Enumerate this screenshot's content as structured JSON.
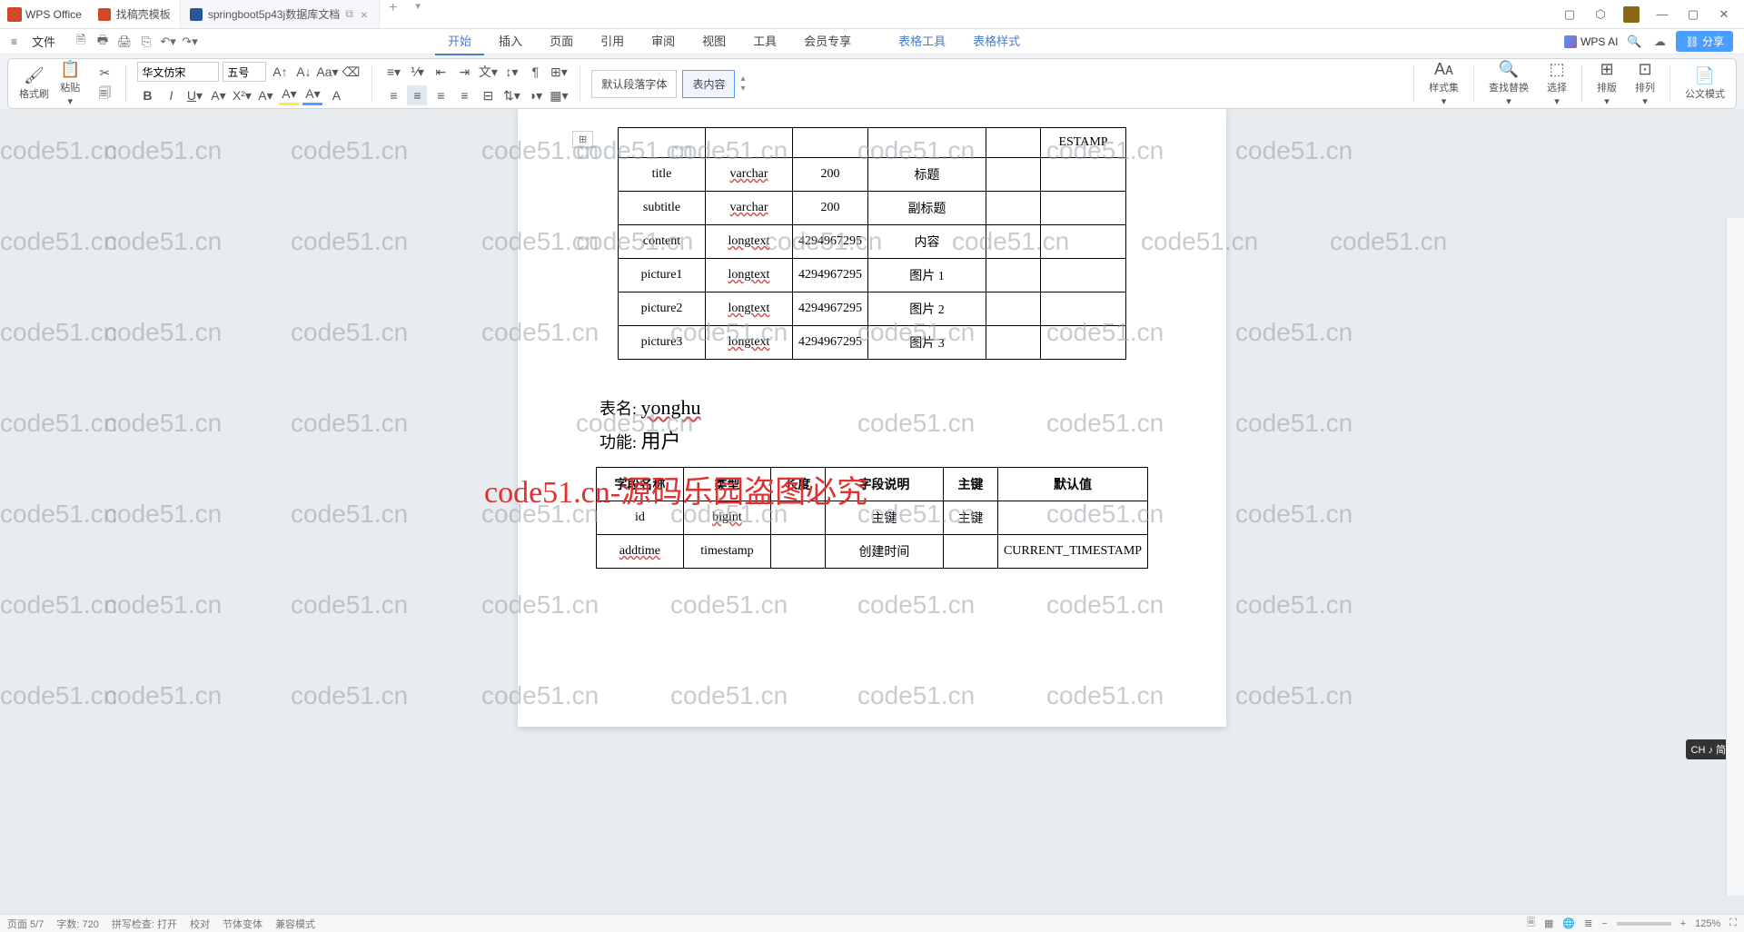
{
  "app": {
    "name": "WPS Office"
  },
  "tabs": [
    {
      "label": "找稿壳模板",
      "icon": "doc"
    },
    {
      "label": "springboot5p43j数据库文档",
      "icon": "word",
      "active": true
    }
  ],
  "file_menu": "文件",
  "menu": {
    "items": [
      "开始",
      "插入",
      "页面",
      "引用",
      "审阅",
      "视图",
      "工具",
      "会员专享"
    ],
    "extra": [
      "表格工具",
      "表格样式"
    ],
    "active": "开始",
    "ai": "WPS AI",
    "share": "分享"
  },
  "ribbon": {
    "format_painter": "格式刷",
    "paste": "粘贴",
    "font_name": "华文仿宋",
    "font_size": "五号",
    "style_default": "默认段落字体",
    "style_table": "表内容",
    "styles": "样式集",
    "find": "查找替换",
    "select": "选择",
    "layout": "排版",
    "arrange": "排列",
    "gov_mode": "公文模式"
  },
  "outline_toggle": "⊞",
  "tables": {
    "t1": {
      "rows": [
        {
          "c1": "",
          "c2": "",
          "c3": "",
          "c4": "",
          "c5": "",
          "c6": "ESTAMP"
        },
        {
          "c1": "title",
          "c2": "varchar",
          "c3": "200",
          "c4": "标题",
          "c5": "",
          "c6": ""
        },
        {
          "c1": "subtitle",
          "c2": "varchar",
          "c3": "200",
          "c4": "副标题",
          "c5": "",
          "c6": ""
        },
        {
          "c1": "content",
          "c2": "longtext",
          "c3": "4294967295",
          "c4": "内容",
          "c5": "",
          "c6": ""
        },
        {
          "c1": "picture1",
          "c2": "longtext",
          "c3": "4294967295",
          "c4": "图片 1",
          "c5": "",
          "c6": ""
        },
        {
          "c1": "picture2",
          "c2": "longtext",
          "c3": "4294967295",
          "c4": "图片 2",
          "c5": "",
          "c6": ""
        },
        {
          "c1": "picture3",
          "c2": "longtext",
          "c3": "4294967295",
          "c4": "图片 3",
          "c5": "",
          "c6": ""
        }
      ]
    },
    "t2": {
      "name_label": "表名:",
      "name_value": "yonghu",
      "func_label": "功能:",
      "func_value": "用户",
      "headers": [
        "字段名称",
        "类型",
        "长度",
        "字段说明",
        "主键",
        "默认值"
      ],
      "rows": [
        {
          "c1": "id",
          "c2": "bigint",
          "c3": "",
          "c4": "主键",
          "c5": "主键",
          "c6": ""
        },
        {
          "c1": "addtime",
          "c2": "timestamp",
          "c3": "",
          "c4": "创建时间",
          "c5": "",
          "c6": "CURRENT_TIMESTAMP"
        }
      ]
    }
  },
  "watermark_text": "code51.cn",
  "red_watermark": "code51.cn-源码乐园盗图必究",
  "ime": "CH ♪ 简",
  "status": {
    "page": "页面 5/7",
    "words": "字数: 720",
    "spell": "拼写检查: 打开",
    "proof": "校对",
    "body": "节体变体",
    "mode": "兼容模式",
    "zoom": "125%"
  }
}
